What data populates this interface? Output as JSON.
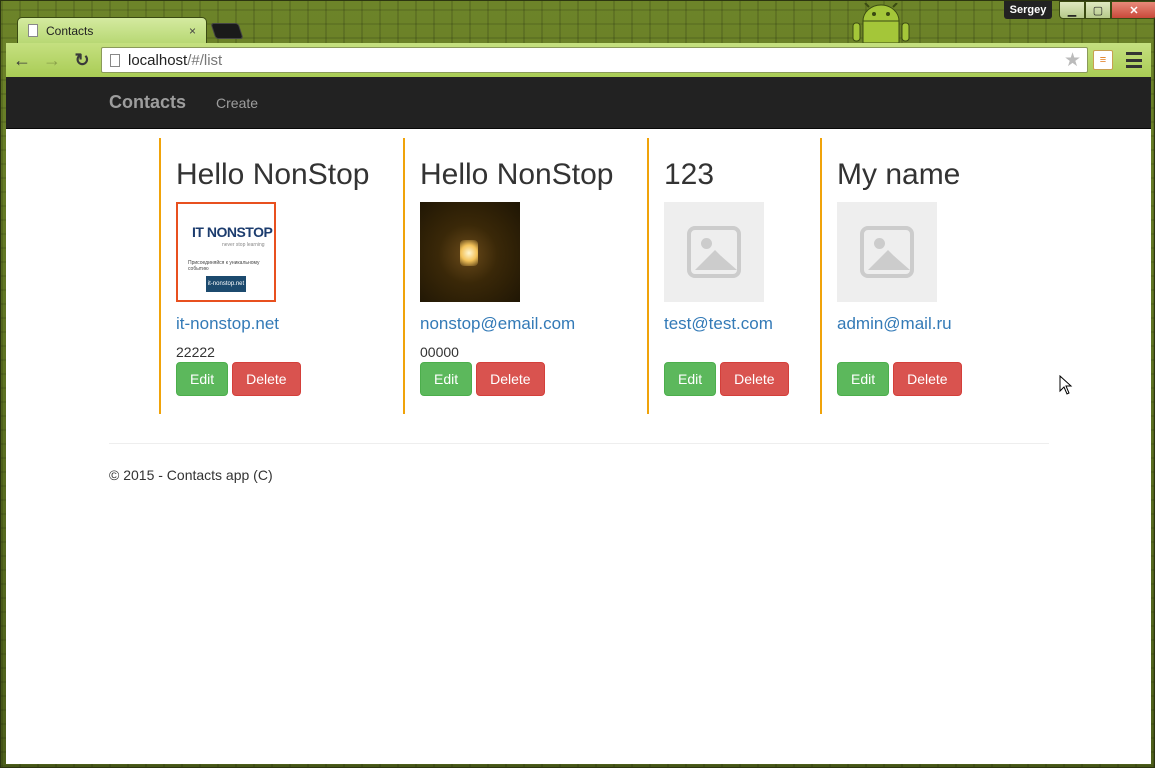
{
  "browser": {
    "tab_title": "Contacts",
    "tab_close": "×",
    "user": "Sergey",
    "url_host": "localhost",
    "url_path": "/#/list"
  },
  "navbar": {
    "brand": "Contacts",
    "create_link": "Create"
  },
  "contacts": [
    {
      "name": "Hello NonStop",
      "email": "it-nonstop.net",
      "phone": "22222",
      "image": "it-nonstop-logo"
    },
    {
      "name": "Hello NonStop",
      "email": "nonstop@email.com",
      "phone": "00000",
      "image": "light-bulb-photo"
    },
    {
      "name": "123",
      "email": "test@test.com",
      "phone": "",
      "image": "placeholder-image-icon"
    },
    {
      "name": "My name",
      "email": "admin@mail.ru",
      "phone": "",
      "image": "placeholder-image-icon"
    }
  ],
  "image_it_nonstop": {
    "brand_mark": "IT NONSTOP",
    "tagline": "never stop learning",
    "invite": "Присоединяйся к уникальному событию",
    "button": "it-nonstop.net"
  },
  "actions": {
    "edit_label": "Edit",
    "delete_label": "Delete"
  },
  "footer": {
    "text": "© 2015 - Contacts app (C)"
  },
  "colors": {
    "accent_border": "#f0a30a",
    "link": "#337ab7",
    "edit": "#5cb85c",
    "delete": "#d9534f",
    "navbar": "#222222"
  }
}
